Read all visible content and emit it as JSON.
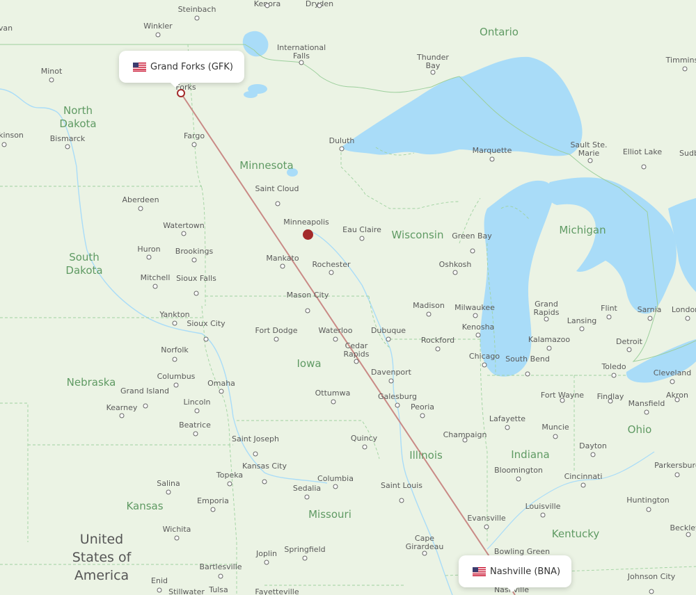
{
  "map": {
    "colors": {
      "land": "#ebf3e4",
      "water": "#a9dcf8",
      "route": "#c98a86",
      "marker": "#a32a2a",
      "region_label": "#5f9a63"
    },
    "route": {
      "origin": {
        "name": "Grand Forks",
        "code": "GFK",
        "label": "Grand Forks (GFK)",
        "flag_icon": "us-flag-icon"
      },
      "destination": {
        "name": "Nashville",
        "code": "BNA",
        "label": "Nashville (BNA)",
        "flag_icon": "us-flag-icon"
      },
      "current_position_marker": "Minneapolis area"
    },
    "countries": [
      {
        "label": "United States of America"
      }
    ],
    "regions": [
      {
        "label": "Ontario"
      },
      {
        "label": "North Dakota"
      },
      {
        "label": "Minnesota"
      },
      {
        "label": "South Dakota"
      },
      {
        "label": "Wisconsin"
      },
      {
        "label": "Michigan"
      },
      {
        "label": "Iowa"
      },
      {
        "label": "Nebraska"
      },
      {
        "label": "Illinois"
      },
      {
        "label": "Indiana"
      },
      {
        "label": "Ohio"
      },
      {
        "label": "Kansas"
      },
      {
        "label": "Missouri"
      },
      {
        "label": "Kentucky"
      }
    ],
    "cities": [
      {
        "label": "Steinbach"
      },
      {
        "label": "Winkler"
      },
      {
        "label": "van"
      },
      {
        "label": "Minot"
      },
      {
        "label": "International Falls"
      },
      {
        "label": "Thunder Bay"
      },
      {
        "label": "Timmins"
      },
      {
        "label": "Forks"
      },
      {
        "label": "kinson"
      },
      {
        "label": "Bismarck"
      },
      {
        "label": "Fargo"
      },
      {
        "label": "Duluth"
      },
      {
        "label": "Marquette"
      },
      {
        "label": "Sault Ste. Marie"
      },
      {
        "label": "Elliot Lake"
      },
      {
        "label": "Sudb"
      },
      {
        "label": "Saint Cloud"
      },
      {
        "label": "Aberdeen"
      },
      {
        "label": "Watertown"
      },
      {
        "label": "Minneapolis"
      },
      {
        "label": "Eau Claire"
      },
      {
        "label": "Green Bay"
      },
      {
        "label": "Huron"
      },
      {
        "label": "Brookings"
      },
      {
        "label": "Mankato"
      },
      {
        "label": "Rochester"
      },
      {
        "label": "Oshkosh"
      },
      {
        "label": "Mitchell"
      },
      {
        "label": "Sioux Falls"
      },
      {
        "label": "Mason City"
      },
      {
        "label": "Madison"
      },
      {
        "label": "Milwaukee"
      },
      {
        "label": "Grand Rapids"
      },
      {
        "label": "Flint"
      },
      {
        "label": "Sarnia"
      },
      {
        "label": "London"
      },
      {
        "label": "Lansing"
      },
      {
        "label": "Yankton"
      },
      {
        "label": "Sioux City"
      },
      {
        "label": "Fort Dodge"
      },
      {
        "label": "Waterloo"
      },
      {
        "label": "Dubuque"
      },
      {
        "label": "Kenosha"
      },
      {
        "label": "Rockford"
      },
      {
        "label": "Detroit"
      },
      {
        "label": "Kalamazoo"
      },
      {
        "label": "Norfolk"
      },
      {
        "label": "Cedar Rapids"
      },
      {
        "label": "Chicago"
      },
      {
        "label": "South Bend"
      },
      {
        "label": "Toledo"
      },
      {
        "label": "Cleveland"
      },
      {
        "label": "Columbus"
      },
      {
        "label": "Davenport"
      },
      {
        "label": "Omaha"
      },
      {
        "label": "Grand Island"
      },
      {
        "label": "Galesburg"
      },
      {
        "label": "Peoria"
      },
      {
        "label": "Fort Wayne"
      },
      {
        "label": "Findlay"
      },
      {
        "label": "Akron"
      },
      {
        "label": "Ottumwa"
      },
      {
        "label": "Lincoln"
      },
      {
        "label": "Kearney"
      },
      {
        "label": "Mansfield"
      },
      {
        "label": "Lafayette"
      },
      {
        "label": "Beatrice"
      },
      {
        "label": "Champaign"
      },
      {
        "label": "Muncie"
      },
      {
        "label": "Quincy"
      },
      {
        "label": "Saint Joseph"
      },
      {
        "label": "Dayton"
      },
      {
        "label": "Kansas City"
      },
      {
        "label": "Parkersburg"
      },
      {
        "label": "Topeka"
      },
      {
        "label": "Bloomington"
      },
      {
        "label": "Cincinnati"
      },
      {
        "label": "Columbia"
      },
      {
        "label": "Salina"
      },
      {
        "label": "Saint Louis"
      },
      {
        "label": "Sedalia"
      },
      {
        "label": "Emporia"
      },
      {
        "label": "Huntington"
      },
      {
        "label": "Louisville"
      },
      {
        "label": "Evansville"
      },
      {
        "label": "Wichita"
      },
      {
        "label": "Beckley"
      },
      {
        "label": "Cape Girardeau"
      },
      {
        "label": "Bowling Green"
      },
      {
        "label": "Joplin"
      },
      {
        "label": "Springfield"
      },
      {
        "label": "Bartlesville"
      },
      {
        "label": "Enid"
      },
      {
        "label": "Johnson City"
      },
      {
        "label": "Stillwater"
      },
      {
        "label": "Tulsa"
      },
      {
        "label": "Fayetteville"
      },
      {
        "label": "Nashville"
      },
      {
        "label": "Kenora"
      },
      {
        "label": "Dryden"
      }
    ]
  }
}
